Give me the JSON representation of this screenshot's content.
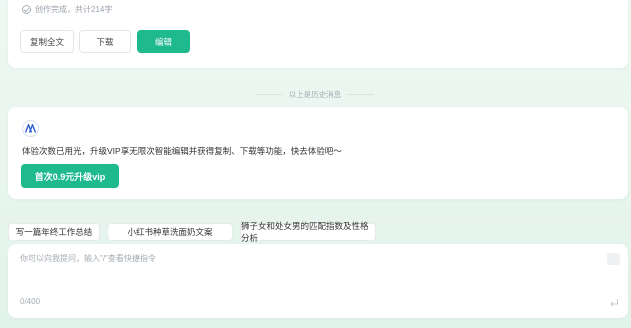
{
  "result": {
    "status": "创作完成，共计214字",
    "copy_label": "复制全文",
    "download_label": "下载",
    "edit_label": "编辑"
  },
  "history": {
    "divider": "以上是历史消息"
  },
  "promo": {
    "logo_icon": "app-logo-icon",
    "message": "体验次数已用光，升级VIP享无限次智能编辑并获得复制、下载等功能，快去体验吧～",
    "upgrade_label": "首次0.9元升级vip"
  },
  "suggestions": [
    "写一篇年终工作总结",
    "小红书种草洗面奶文案",
    "狮子女和处女男的匹配指数及性格分析"
  ],
  "input": {
    "placeholder": "你可以向我提问，输入\"/\"查看快捷指令",
    "count": "0/400"
  },
  "colors": {
    "accent": "#1fb98e",
    "background": "#e7f5ee"
  }
}
